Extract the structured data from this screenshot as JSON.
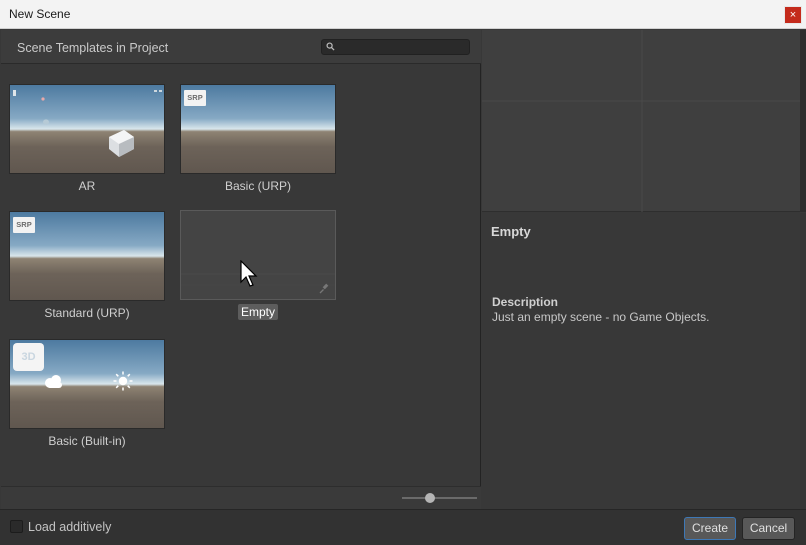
{
  "window": {
    "title": "New Scene",
    "close_label": "×"
  },
  "templates_panel": {
    "heading": "Scene Templates in Project",
    "search": {
      "value": "",
      "placeholder": ""
    }
  },
  "templates": [
    {
      "name": "AR",
      "badge": ""
    },
    {
      "name": "Basic (URP)",
      "badge": "SRP"
    },
    {
      "name": "Standard (URP)",
      "badge": "SRP"
    },
    {
      "name": "Empty",
      "badge": "",
      "selected": true
    },
    {
      "name": "Basic (Built-in)",
      "badge": "3D"
    }
  ],
  "details": {
    "title": "Empty",
    "description_label": "Description",
    "description": "Just an empty scene - no Game Objects."
  },
  "footer": {
    "load_additively_label": "Load additively",
    "load_additively_checked": false,
    "create_label": "Create",
    "cancel_label": "Cancel"
  },
  "zoom": {
    "level": 0.35
  },
  "colors": {
    "accent": "#3e78b6",
    "close": "#c42b1c",
    "panel_bg": "#383838"
  },
  "icons": [
    "search-icon",
    "pin-icon",
    "pointer-cursor-icon",
    "cloud-icon",
    "sun-icon"
  ]
}
